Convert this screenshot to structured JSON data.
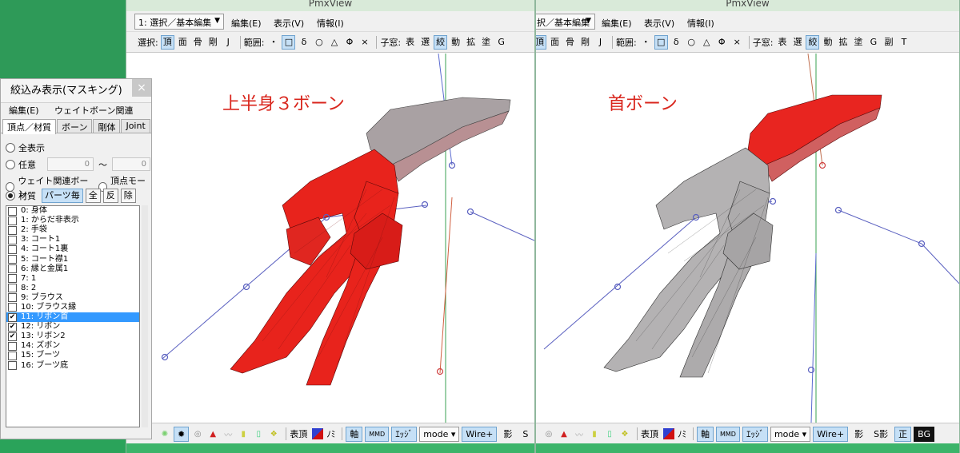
{
  "app_title": "PmxView",
  "left_window": {
    "mode_select": "1: 選択／基本編集",
    "menus": [
      "編集(E)",
      "表示(V)",
      "情報(I)"
    ],
    "toolbar2": {
      "select_label": "選択:",
      "select_items": [
        {
          "label": "頂",
          "on": true
        },
        {
          "label": "面",
          "on": false
        },
        {
          "label": "骨",
          "on": false
        },
        {
          "label": "剛",
          "on": false
        },
        {
          "label": "J",
          "on": false
        }
      ],
      "range_label": "範囲:",
      "range_items": [
        {
          "label": "・",
          "on": false
        },
        {
          "label": "□",
          "on": true
        },
        {
          "label": "δ",
          "on": false
        },
        {
          "label": "○",
          "on": false
        },
        {
          "label": "△",
          "on": false
        },
        {
          "label": "Φ",
          "on": false
        },
        {
          "label": "×",
          "on": false
        }
      ],
      "subwin_label": "子窓:",
      "subwin_items": [
        {
          "label": "表",
          "on": false
        },
        {
          "label": "選",
          "on": false
        },
        {
          "label": "絞",
          "on": true
        },
        {
          "label": "動",
          "on": false
        },
        {
          "label": "拡",
          "on": false
        },
        {
          "label": "塗",
          "on": false
        },
        {
          "label": "G",
          "on": false
        }
      ]
    },
    "callout": "上半身３ボーン",
    "mesh_color": "red"
  },
  "right_window": {
    "mode_select": "択／基本編集",
    "menus": [
      "編集(E)",
      "表示(V)",
      "情報(I)"
    ],
    "toolbar2": {
      "select_items": [
        {
          "label": "頂",
          "on": true
        },
        {
          "label": "面",
          "on": false
        },
        {
          "label": "骨",
          "on": false
        },
        {
          "label": "剛",
          "on": false
        },
        {
          "label": "J",
          "on": false
        }
      ],
      "range_label": "範囲:",
      "range_items": [
        {
          "label": "・",
          "on": false
        },
        {
          "label": "□",
          "on": true
        },
        {
          "label": "δ",
          "on": false
        },
        {
          "label": "○",
          "on": false
        },
        {
          "label": "△",
          "on": false
        },
        {
          "label": "Φ",
          "on": false
        },
        {
          "label": "×",
          "on": false
        }
      ],
      "subwin_label": "子窓:",
      "subwin_items": [
        {
          "label": "表",
          "on": false
        },
        {
          "label": "選",
          "on": false
        },
        {
          "label": "絞",
          "on": true
        },
        {
          "label": "動",
          "on": false
        },
        {
          "label": "拡",
          "on": false
        },
        {
          "label": "塗",
          "on": false
        },
        {
          "label": "G",
          "on": false
        },
        {
          "label": "副",
          "on": false
        },
        {
          "label": "T",
          "on": false
        }
      ]
    },
    "callout": "首ボーン",
    "mesh_color": "gray"
  },
  "bottom_bar": {
    "hyochou": "表頂",
    "mi": "ﾉﾐ",
    "jiku": "軸",
    "mmd": "MMD",
    "edge": "ｴｯｼﾞ",
    "mode": "mode",
    "wire": "Wire+",
    "kage": "影",
    "s_kage": "S影",
    "sei": "正",
    "bg": "BG",
    "s_cut": "S"
  },
  "panel": {
    "title": "絞込み表示(マスキング)",
    "close": "×",
    "menus": [
      "編集(E)",
      "ウェイトボーン関連(B)"
    ],
    "tabs": [
      {
        "label": "頂点／材質",
        "active": true
      },
      {
        "label": "ボーン",
        "active": false
      },
      {
        "label": "剛体",
        "active": false
      },
      {
        "label": "Joint",
        "active": false
      }
    ],
    "opt_all": "全表示",
    "opt_any": "任意",
    "any_from": "0",
    "tilde": "～",
    "any_to": "0",
    "opt_weight": "ウェイト関連ボーン",
    "opt_morph": "頂点モーフ",
    "opt_material": "材質",
    "btn_parts": "パーツ毎",
    "btn_all": "全",
    "btn_inv": "反",
    "btn_del": "除",
    "materials": [
      {
        "label": "0: 身体",
        "checked": false,
        "selected": false
      },
      {
        "label": "1: からだ非表示",
        "checked": false,
        "selected": false
      },
      {
        "label": "2: 手袋",
        "checked": false,
        "selected": false
      },
      {
        "label": "3: コート1",
        "checked": false,
        "selected": false
      },
      {
        "label": "4: コート1裏",
        "checked": false,
        "selected": false
      },
      {
        "label": "5: コート襟1",
        "checked": false,
        "selected": false
      },
      {
        "label": "6: 縁と金属1",
        "checked": false,
        "selected": false
      },
      {
        "label": "7: 1",
        "checked": false,
        "selected": false
      },
      {
        "label": "8: 2",
        "checked": false,
        "selected": false
      },
      {
        "label": "9: ブラウス",
        "checked": false,
        "selected": false
      },
      {
        "label": "10: ブラウス縁",
        "checked": false,
        "selected": false
      },
      {
        "label": "11: リボン首",
        "checked": true,
        "selected": true
      },
      {
        "label": "12: リボン",
        "checked": true,
        "selected": false
      },
      {
        "label": "13: リボン2",
        "checked": true,
        "selected": false
      },
      {
        "label": "14: ズボン",
        "checked": false,
        "selected": false
      },
      {
        "label": "15: ブーツ",
        "checked": false,
        "selected": false
      },
      {
        "label": "16: ブーツ底",
        "checked": false,
        "selected": false
      }
    ]
  }
}
